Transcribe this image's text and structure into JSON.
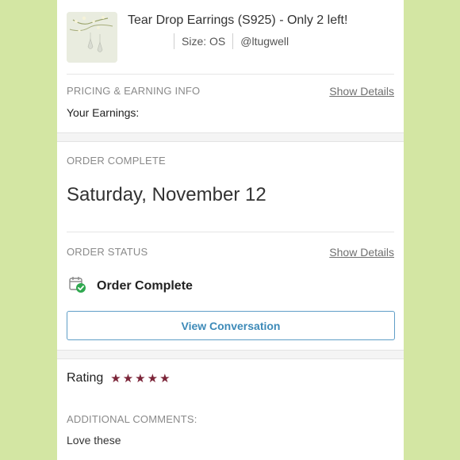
{
  "item": {
    "title": "Tear Drop Earrings (S925) - Only 2 left!",
    "size": "Size: OS",
    "seller": "@ltugwell"
  },
  "pricing": {
    "label": "PRICING & EARNING INFO",
    "show_details": "Show Details",
    "earnings_label": "Your Earnings:"
  },
  "order_complete": {
    "label": "ORDER COMPLETE",
    "date": "Saturday, November 12"
  },
  "order_status": {
    "label": "ORDER STATUS",
    "show_details": "Show Details",
    "status": "Order Complete",
    "view_conversation": "View Conversation"
  },
  "rating": {
    "label": "Rating",
    "stars": 5,
    "additional_comments_label": "ADDITIONAL COMMENTS:",
    "comment": "Love these"
  },
  "colors": {
    "background": "#d3e6a3",
    "accent_blue": "#3d8ab8",
    "star": "#7b2438",
    "status_green": "#2fa84f"
  },
  "icons": {
    "order_status": "calendar-check-icon",
    "star": "star-icon"
  }
}
